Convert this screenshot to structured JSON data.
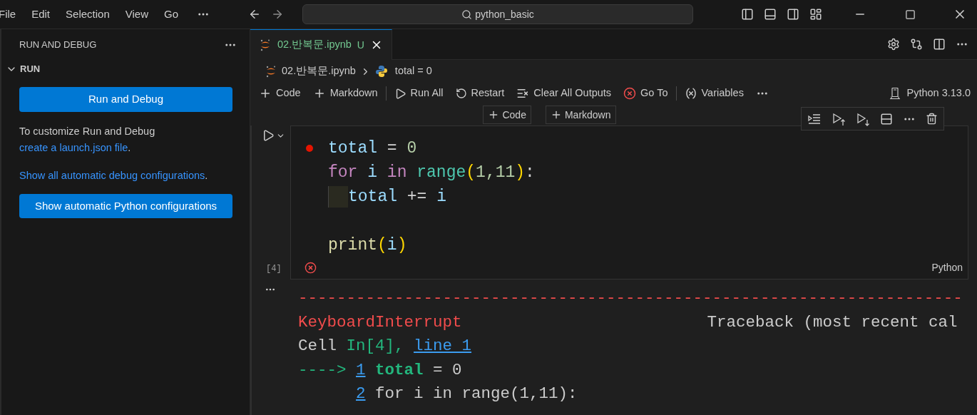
{
  "menu": [
    {
      "label": "File"
    },
    {
      "label": "Edit"
    },
    {
      "label": "Selection"
    },
    {
      "label": "View"
    },
    {
      "label": "Go"
    }
  ],
  "command_center": {
    "label": "python_basic"
  },
  "sidebar": {
    "title": "RUN AND DEBUG",
    "section": {
      "label": "RUN",
      "expanded": true
    },
    "primary_button": "Run and Debug",
    "help": [
      [
        {
          "text": "To customize Run and Debug ",
          "kind": "text"
        },
        {
          "text": "create a launch.json file",
          "kind": "link"
        },
        {
          "text": ".",
          "kind": "text"
        }
      ],
      [
        {
          "text": "Show all automatic debug configurations",
          "kind": "link"
        },
        {
          "text": ".",
          "kind": "text"
        }
      ]
    ],
    "secondary_button": "Show automatic Python configurations"
  },
  "tabs": [
    {
      "label": "02.반복문.ipynb",
      "badge": "U",
      "selected": true
    }
  ],
  "breadcrumbs": [
    {
      "label": "02.반복문.ipynb",
      "kind": "notebook"
    },
    {
      "label": "total = 0",
      "kind": "python"
    }
  ],
  "toolbar": [
    {
      "label": "Code",
      "kind": "plus"
    },
    {
      "label": "Markdown",
      "kind": "plus"
    },
    {
      "kind": "separator"
    },
    {
      "label": "Run All",
      "kind": "run"
    },
    {
      "label": "Restart",
      "kind": "restart"
    },
    {
      "label": "Clear All Outputs",
      "kind": "clear"
    },
    {
      "label": "Go To",
      "kind": "goto"
    },
    {
      "kind": "separator"
    },
    {
      "label": "Variables",
      "kind": "variables"
    },
    {
      "kind": "more"
    }
  ],
  "kernel": "Python 3.13.0",
  "insert_buttons": [
    {
      "label": "Code"
    },
    {
      "label": "Markdown"
    }
  ],
  "cell": {
    "execution_count": "[4]",
    "failed": true,
    "language": "Python",
    "lines": [
      {
        "breakpoint": true,
        "indented": false,
        "tokens": [
          {
            "text": "total",
            "kind": "var"
          },
          {
            "text": " = ",
            "kind": "op"
          },
          {
            "text": "0",
            "kind": "num"
          }
        ]
      },
      {
        "breakpoint": false,
        "indented": false,
        "tokens": [
          {
            "text": "for ",
            "kind": "kw"
          },
          {
            "text": "i ",
            "kind": "var"
          },
          {
            "text": "in ",
            "kind": "kw"
          },
          {
            "text": "range",
            "kind": "func"
          },
          {
            "text": "(",
            "kind": "paren"
          },
          {
            "text": "1,11",
            "kind": "num"
          },
          {
            "text": ")",
            "kind": "paren"
          },
          {
            "text": ":",
            "kind": "op"
          }
        ]
      },
      {
        "breakpoint": false,
        "indented": true,
        "tokens": [
          {
            "text": "total",
            "kind": "var"
          },
          {
            "text": " += ",
            "kind": "op"
          },
          {
            "text": "i",
            "kind": "var"
          }
        ]
      },
      {
        "breakpoint": false,
        "indented": false
      },
      {
        "breakpoint": false,
        "indented": false,
        "tokens": [
          {
            "text": "print",
            "kind": "fn"
          },
          {
            "text": "(",
            "kind": "paren"
          },
          {
            "text": "i",
            "kind": "var"
          },
          {
            "text": ")",
            "kind": "paren"
          }
        ]
      }
    ]
  },
  "output": {
    "rule": "---------------------------------------------------------------------",
    "error_name": "KeyboardInterrupt",
    "traceback_header": "Traceback (most recent cal",
    "lines": [
      {
        "tokens": [
          {
            "text": "Cell ",
            "kind": "plain"
          },
          {
            "text": "In[4], ",
            "kind": "green"
          },
          {
            "text": "line 1",
            "kind": "link"
          }
        ]
      },
      {
        "marker": "---->",
        "number": "1",
        "tokens": [
          {
            "text": "total",
            "kind": "green_bold"
          },
          {
            "text": " = 0",
            "kind": "plain"
          }
        ]
      },
      {
        "number": "2",
        "tokens": [
          {
            "text": "for i in range(1,11):",
            "kind": "plain"
          }
        ]
      }
    ]
  }
}
